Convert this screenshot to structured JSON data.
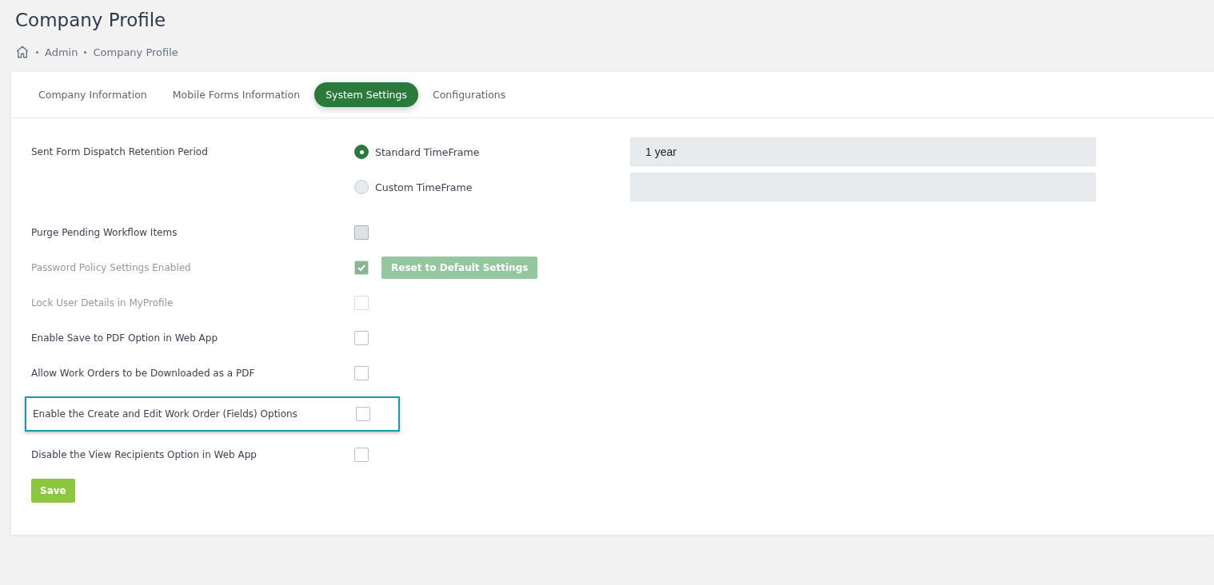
{
  "page": {
    "title": "Company Profile"
  },
  "breadcrumb": [
    "Admin",
    "Company Profile"
  ],
  "tabs": [
    {
      "label": "Company Information",
      "selected": false
    },
    {
      "label": "Mobile Forms Information",
      "selected": false
    },
    {
      "label": "System Settings",
      "selected": true
    },
    {
      "label": "Configurations",
      "selected": false
    }
  ],
  "settings": [
    {
      "kind": "radio",
      "label": "Sent Form Dispatch Retention Period",
      "options": [
        {
          "label": "Standard TimeFrame",
          "selected": true,
          "value": "1 year"
        },
        {
          "label": "Custom TimeFrame",
          "selected": false
        }
      ]
    },
    {
      "kind": "checkbox",
      "label": "Purge Pending Workflow Items",
      "checked": false,
      "disabled": true,
      "faded": false,
      "highlighted": false
    },
    {
      "kind": "checkbox",
      "label": "Password Policy Settings Enabled",
      "checked": true,
      "disabled": false,
      "faded": true,
      "highlighted": false,
      "button": "Reset to Default Settings"
    },
    {
      "kind": "checkbox",
      "label": "Lock User Details in MyProfile",
      "checked": false,
      "disabled": false,
      "faded": true,
      "highlighted": false
    },
    {
      "kind": "checkbox",
      "label": "Enable Save to PDF Option in Web App",
      "checked": false,
      "disabled": false,
      "faded": false,
      "highlighted": false
    },
    {
      "kind": "checkbox",
      "label": "Allow Work Orders to be Downloaded as a PDF",
      "checked": false,
      "disabled": false,
      "faded": false,
      "highlighted": false
    },
    {
      "kind": "checkbox",
      "label": "Enable the Create and Edit Work Order (Fields) Options",
      "checked": false,
      "disabled": false,
      "faded": false,
      "highlighted": true
    },
    {
      "kind": "checkbox",
      "label": "Disable the View Recipients Option in Web App",
      "checked": false,
      "disabled": false,
      "faded": false,
      "highlighted": false
    }
  ],
  "save_button": "Save"
}
